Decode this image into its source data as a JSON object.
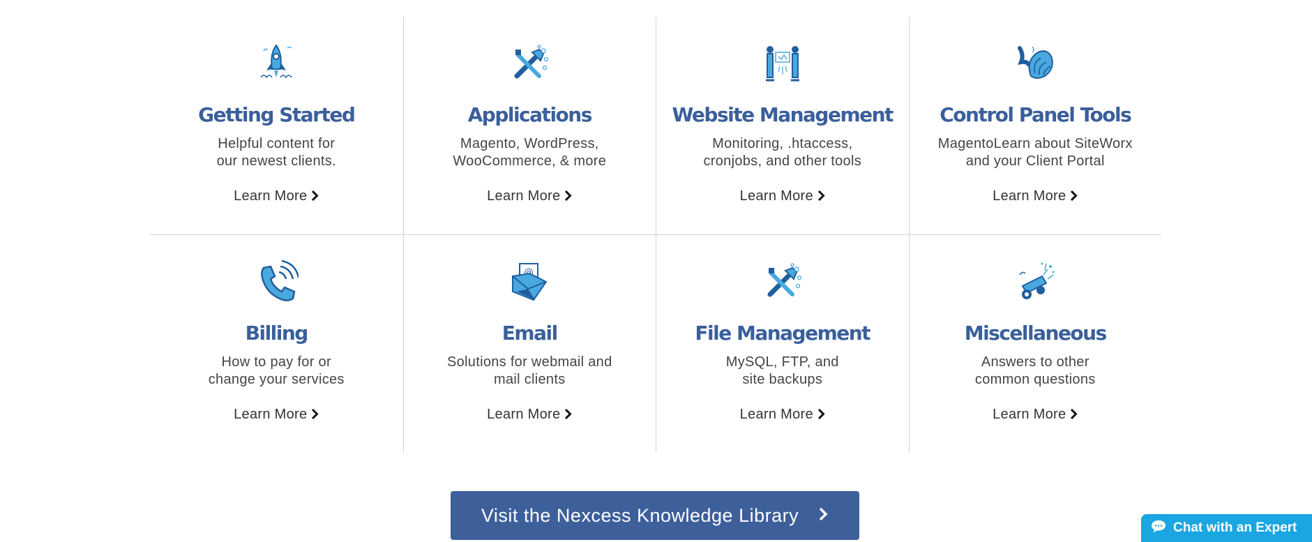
{
  "categories": [
    {
      "title": "Getting Started",
      "desc": [
        "Helpful content for",
        "our newest clients."
      ],
      "link": "Learn More",
      "icon": "rocket-icon"
    },
    {
      "title": "Applications",
      "desc": [
        "Magento, WordPress,",
        "WooCommerce, & more"
      ],
      "link": "Learn More",
      "icon": "tools-icon"
    },
    {
      "title": "Website Management",
      "desc": [
        "Monitoring, .htaccess,",
        "cronjobs, and other tools"
      ],
      "link": "Learn More",
      "icon": "servers-icon"
    },
    {
      "title": "Control Panel Tools",
      "desc": [
        "MagentoLearn about SiteWorx",
        "and your Client Portal"
      ],
      "link": "Learn More",
      "icon": "shell-icon"
    },
    {
      "title": "Billing",
      "desc": [
        "How to pay for or",
        "change your services"
      ],
      "link": "Learn More",
      "icon": "phone-icon"
    },
    {
      "title": "Email",
      "desc": [
        "Solutions for webmail and",
        "mail clients"
      ],
      "link": "Learn More",
      "icon": "envelope-icon"
    },
    {
      "title": "File Management",
      "desc": [
        "MySQL, FTP, and",
        "site backups"
      ],
      "link": "Learn More",
      "icon": "tools-icon"
    },
    {
      "title": "Miscellaneous",
      "desc": [
        "Answers to other",
        "common questions"
      ],
      "link": "Learn More",
      "icon": "cannon-icon"
    }
  ],
  "cta": {
    "label": "Visit the Nexcess Knowledge Library"
  },
  "chat": {
    "label": "Chat with an Expert"
  },
  "colors": {
    "title": "#3a5f9b",
    "cta_bg": "#3d5f9a",
    "chat_bg": "#1ba6e1",
    "icon_dark": "#1f5f9e",
    "icon_light": "#49a9de"
  }
}
